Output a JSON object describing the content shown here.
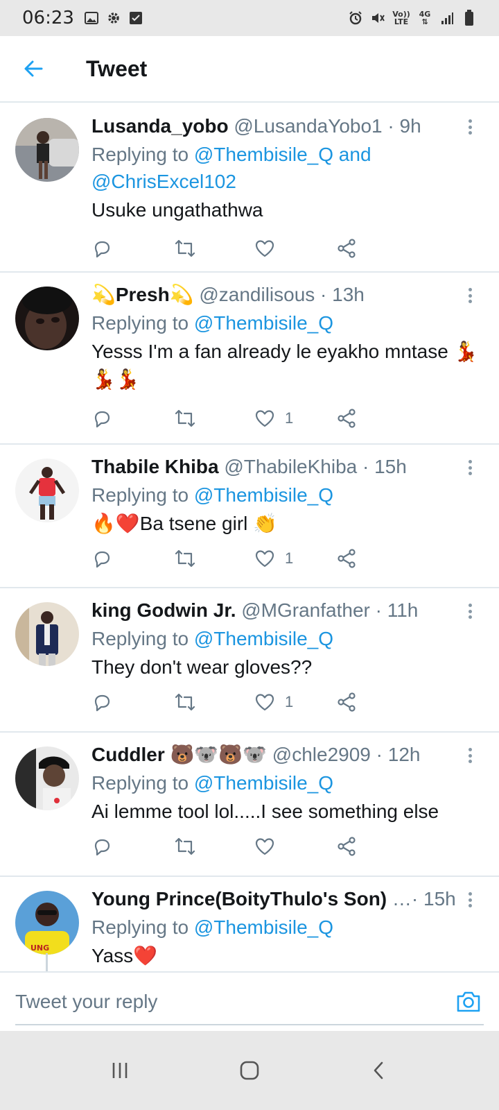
{
  "status_bar": {
    "time": "06:23",
    "left_icons": [
      "gallery-icon",
      "gear-icon",
      "check-box-icon"
    ],
    "right_icons": [
      "alarm-icon",
      "mute-icon",
      "volte-icon",
      "4g-icon",
      "signal-icon",
      "battery-icon"
    ],
    "volte_label_top": "Vo))",
    "volte_label_bottom": "LTE",
    "network_label": "4G"
  },
  "header": {
    "title": "Tweet",
    "back_icon": "arrow-left-icon"
  },
  "colors": {
    "accent": "#1da1f2",
    "mention": "#1b95e0",
    "secondary_text": "#657786",
    "divider": "#e1e8ed",
    "system_bar": "#e8e8e8"
  },
  "tweets": [
    {
      "name": "Lusanda_yobo",
      "meta": " @LusandaYobo1 · 9h",
      "reply_prefix": "Replying to ",
      "mentions": "@Thembisile_Q and @ChrisExcel102",
      "text": "Usuke ungathathwa",
      "likes": ""
    },
    {
      "name": "💫Presh💫",
      "meta": " @zandilisous · 13h",
      "reply_prefix": "Replying to ",
      "mentions": "@Thembisile_Q",
      "text": "Yesss I'm a fan already le eyakho mntase 💃💃💃",
      "likes": "1"
    },
    {
      "name": "Thabile Khiba",
      "meta": " @ThabileKhiba · 15h",
      "reply_prefix": "Replying to ",
      "mentions": "@Thembisile_Q",
      "text": "🔥❤️Ba tsene girl 👏",
      "likes": "1"
    },
    {
      "name": "king Godwin Jr.",
      "meta": " @MGranfather · 11h",
      "reply_prefix": "Replying to ",
      "mentions": "@Thembisile_Q",
      "text": "They don't wear gloves??",
      "likes": "1"
    },
    {
      "name": "Cuddler 🐻🐨🐻🐨",
      "meta": " @chle2909 · 12h",
      "reply_prefix": "Replying to ",
      "mentions": "@Thembisile_Q",
      "text": "Ai lemme tool lol.....I see something else",
      "likes": ""
    },
    {
      "name": "Young Prince(BoityThulo's Son)",
      "meta": " …· 15h",
      "reply_prefix": "Replying to ",
      "mentions": "@Thembisile_Q",
      "text": "Yass❤️",
      "likes": ""
    }
  ],
  "action_icons": [
    "reply-icon",
    "retweet-icon",
    "like-icon",
    "share-icon"
  ],
  "reply_bar": {
    "placeholder": "Tweet your reply",
    "camera_icon": "camera-icon"
  },
  "nav_bar": {
    "icons": [
      "recent-apps-icon",
      "home-icon",
      "back-icon"
    ]
  }
}
